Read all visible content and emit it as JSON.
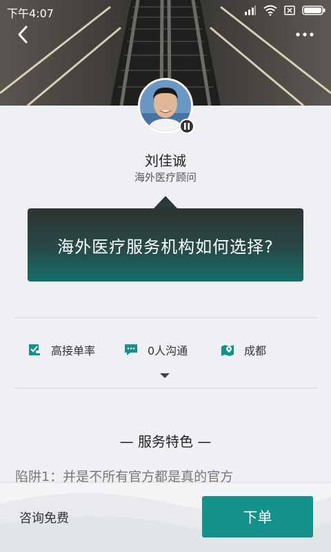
{
  "status_bar": {
    "time": "下午4:07"
  },
  "advisor": {
    "name": "刘佳诚",
    "title": "海外医疗顾问"
  },
  "card": {
    "text": "海外医疗服务机构如何选择?"
  },
  "stats": [
    {
      "icon": "check-doc-icon",
      "label": "高接单率"
    },
    {
      "icon": "chat-bubble-icon",
      "label": "0人沟通"
    },
    {
      "icon": "map-pin-icon",
      "label": "成都"
    }
  ],
  "section": {
    "title": "— 服务特色 —",
    "preview": "陷阱1：并是不所有官方都是真的官方"
  },
  "bottom": {
    "consult_label": "咨询免费",
    "order_label": "下单"
  },
  "colors": {
    "accent": "#14918b",
    "card_dark": "#2e3231",
    "card_teal": "#166e69"
  }
}
